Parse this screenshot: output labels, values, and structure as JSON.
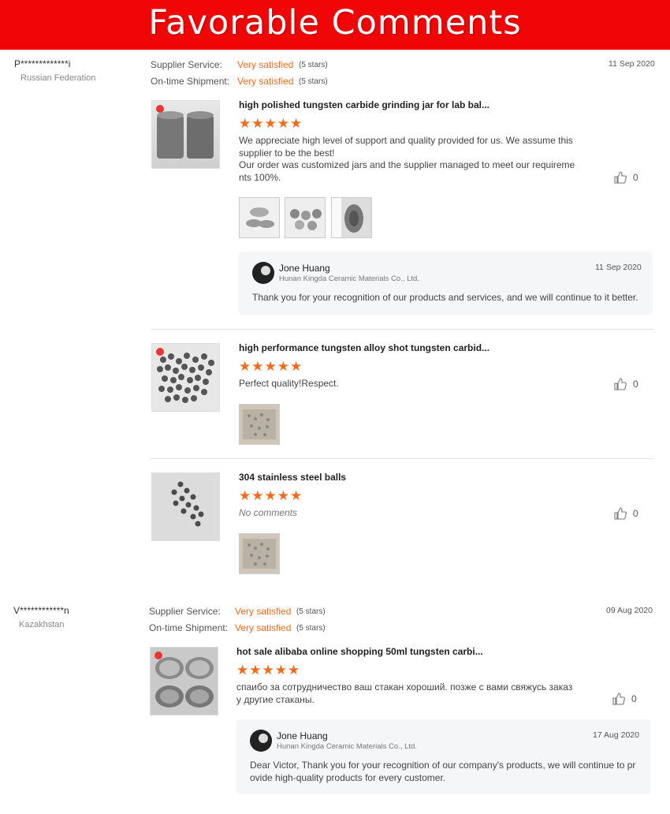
{
  "banner": {
    "title": "Favorable Comments"
  },
  "reviews": [
    {
      "buyer": "P*************i",
      "country": "Russian Federation",
      "date": "11 Sep 2020",
      "supplier_label": "Supplier Service:",
      "supplier_value": "Very satisfied",
      "supplier_stars": "(5 stars)",
      "shipment_label": "On-time Shipment:",
      "shipment_value": "Very satisfied",
      "shipment_stars": "(5 stars)",
      "products": [
        {
          "title": "high polished tungsten carbide grinding jar for lab bal...",
          "stars": "★★★★★",
          "text": "We appreciate high level of support and quality provided for us. We assume this supplier to be the best!\nOur order was customized jars and the supplier managed to meet our requirements 100%.",
          "likes": "0",
          "reply": {
            "name": "Jone Huang",
            "company": "Hunan Kingda Ceramic Materials Co., Ltd.",
            "date": "11 Sep 2020",
            "text": "Thank you for your recognition of our products and services, and we will continue to it better."
          }
        },
        {
          "title": "high performance tungsten alloy shot tungsten carbid...",
          "stars": "★★★★★",
          "text": "Perfect quality!Respect.",
          "likes": "0"
        },
        {
          "title": "304 stainless steel balls",
          "stars": "★★★★★",
          "text": "No comments",
          "likes": "0"
        }
      ]
    },
    {
      "buyer": "V************n",
      "country": "Kazakhstan",
      "date": "09 Aug 2020",
      "supplier_label": "Supplier Service:",
      "supplier_value": "Very satisfied",
      "supplier_stars": "(5 stars)",
      "shipment_label": "On-time Shipment:",
      "shipment_value": "Very satisfied",
      "shipment_stars": "(5 stars)",
      "products": [
        {
          "title": "hot sale alibaba online shopping 50ml tungsten carbi...",
          "stars": "★★★★★",
          "text": "спаибо за сотрудничество ваш стакан хороший. позже с вами свяжусь заказ у другие стаканы.",
          "likes": "0",
          "reply": {
            "name": "Jone Huang",
            "company": "Hunan Kingda Ceramic Materials Co., Ltd.",
            "date": "17 Aug 2020",
            "text": "Dear Victor, Thank you for your recognition of our company's products, we will continue to provide high-quality products for every customer."
          }
        }
      ]
    }
  ],
  "colors": {
    "banner": "#f00606",
    "accent": "#f26b1d"
  },
  "icons": {
    "like": "thumbs-up-icon"
  }
}
